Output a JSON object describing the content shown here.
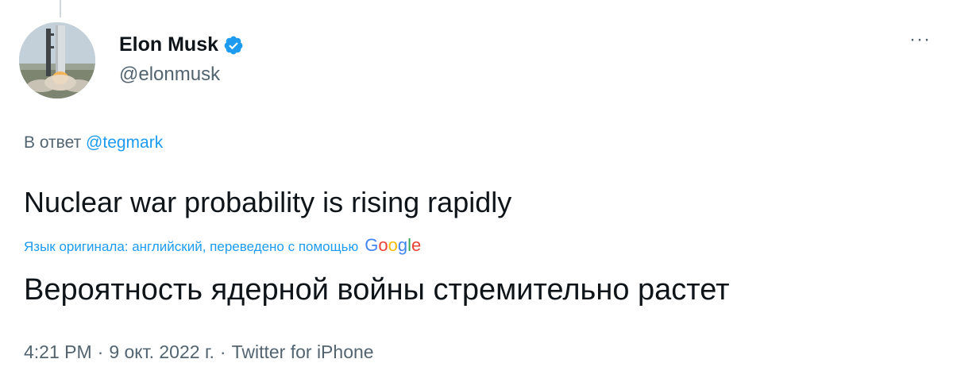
{
  "author": {
    "display_name": "Elon Musk",
    "handle": "@elonmusk",
    "verified": true
  },
  "more_menu": {
    "label": "···"
  },
  "reply": {
    "prefix": "В ответ",
    "mention": "@tegmark"
  },
  "tweet": {
    "text": "Nuclear war probability is rising rapidly",
    "translation_note": "Язык оригинала: английский, переведено с помощью",
    "translation_provider": "Google",
    "translated_text": "Вероятность ядерной войны стремительно растет"
  },
  "meta": {
    "time": "4:21 PM",
    "separator": "·",
    "date": "9 окт. 2022 г.",
    "source": "Twitter for iPhone"
  },
  "colors": {
    "link_blue": "#1d9bf0",
    "secondary_text": "#536471",
    "primary_text": "#0f1419",
    "google_blue": "#4285f4",
    "google_red": "#ea4335",
    "google_yellow": "#fbbc05",
    "google_green": "#34a853"
  },
  "icons": {
    "avatar": "rocket-launch-avatar",
    "verified": "verified-badge-icon",
    "more": "more-options-icon"
  }
}
